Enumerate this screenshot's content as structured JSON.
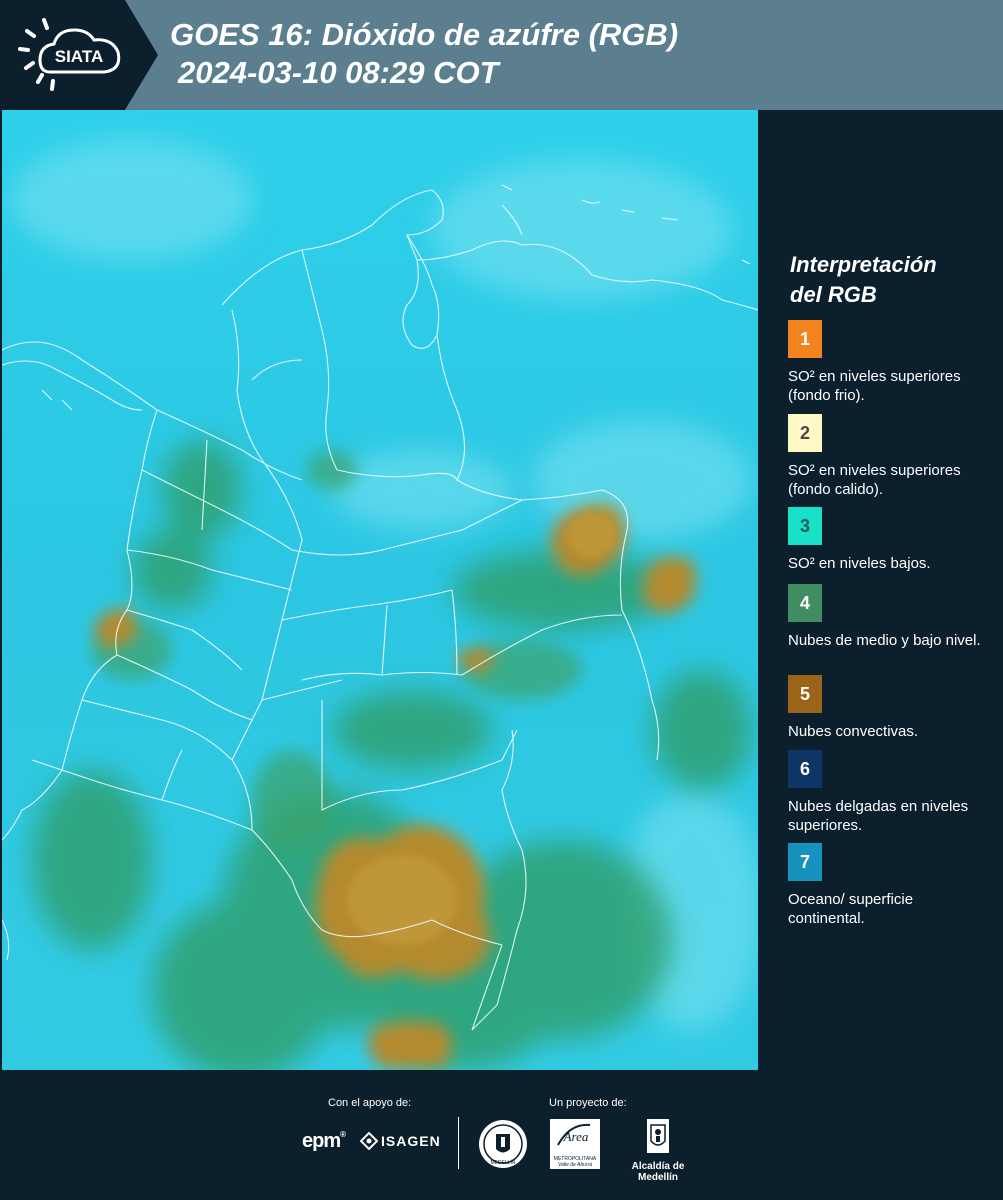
{
  "header": {
    "logo_text": "SIATA",
    "title_line1": "GOES 16: Dióxido de azúfre (RGB)",
    "title_line2": "2024-03-10 08:29 COT",
    "colors": {
      "header_bg": "#5b7f8f",
      "logo_bg": "#0c1f2c"
    }
  },
  "map": {
    "icon": "satellite-map-image"
  },
  "legend": {
    "title_line1": "Interpretación",
    "title_line2": "del RGB",
    "items": [
      {
        "num": "1",
        "text": "SO² en niveles superiores (fondo frio).",
        "color": "#f4821f",
        "num_color": "#ffffff"
      },
      {
        "num": "2",
        "text": "SO² en niveles superiores (fondo calido).",
        "color": "#fff8c6",
        "num_color": "#4a4a4a"
      },
      {
        "num": "3",
        "text": "SO² en niveles bajos.",
        "color": "#19e0c8",
        "num_color": "#1d5f5a"
      },
      {
        "num": "4",
        "text": "Nubes de medio y bajo nivel.",
        "color": "#3f8d61",
        "num_color": "#ffffff"
      },
      {
        "num": "5",
        "text": "Nubes convectivas.",
        "color": "#9c6418",
        "num_color": "#ffffff"
      },
      {
        "num": "6",
        "text": "Nubes delgadas en niveles superiores.",
        "color": "#0f3566",
        "num_color": "#ffffff"
      },
      {
        "num": "7",
        "text": "Oceano/ superficie continental.",
        "color": "#1592bd",
        "num_color": "#ffffff"
      }
    ]
  },
  "footer": {
    "support_label": "Con el apoyo de:",
    "project_label": "Un proyecto de:",
    "epm": "epm",
    "isagen": "ISAGEN",
    "metro_area": "Área",
    "metro_sub1": "METROPOLITANA",
    "metro_sub2": "Valle de Aburrá",
    "medellin": "Alcaldía de Medellín",
    "seal_text": "MEDELLÍN"
  }
}
